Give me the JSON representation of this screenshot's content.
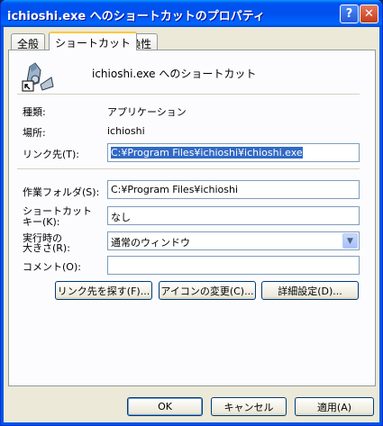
{
  "window": {
    "title": "ichioshi.exe へのショートカットのプロパティ"
  },
  "titlebar": {
    "help_label": "?",
    "close_label": "✕"
  },
  "tabs": [
    {
      "label": "全般",
      "active": false
    },
    {
      "label": "ショートカット",
      "active": true
    },
    {
      "label": "互換性",
      "active": false
    }
  ],
  "header": {
    "name": "ichioshi.exe へのショートカット",
    "icon": "shortcut-file-icon"
  },
  "info": {
    "type_label": "種類:",
    "type_value": "アプリケーション",
    "location_label": "場所:",
    "location_value": "ichioshi"
  },
  "form": {
    "target_label": "リンク先(T):",
    "target_value": "C:¥Program Files¥ichioshi¥ichioshi.exe",
    "workdir_label": "作業フォルダ(S):",
    "workdir_value": "C:¥Program Files¥ichioshi",
    "shortcut_key_label_1": "ショートカット",
    "shortcut_key_label_2": "キー(K):",
    "shortcut_key_value": "なし",
    "run_label_1": "実行時の",
    "run_label_2": "大きさ(R):",
    "run_value": "通常のウィンドウ",
    "comment_label": "コメント(O):",
    "comment_value": ""
  },
  "actions": {
    "find_target": "リンク先を探す(F)...",
    "change_icon": "アイコンの変更(C)...",
    "advanced": "詳細設定(D)..."
  },
  "footer": {
    "ok": "OK",
    "cancel": "キャンセル",
    "apply": "適用(A)"
  }
}
